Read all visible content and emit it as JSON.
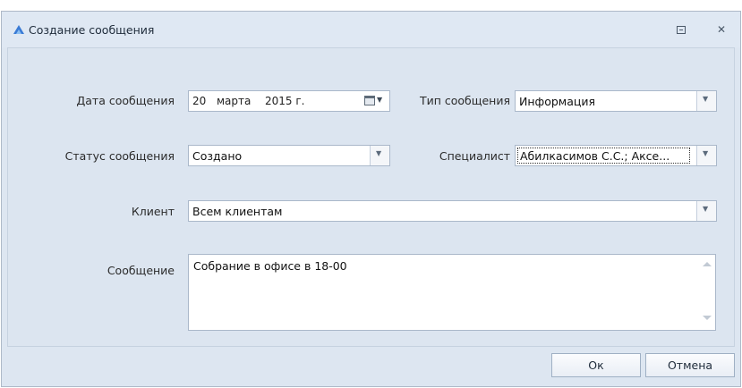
{
  "window": {
    "title": "Создание сообщения",
    "icons": {
      "app": "triangle-app-icon",
      "restore": "restore-icon",
      "close": "close-icon"
    }
  },
  "form": {
    "date": {
      "label": "Дата сообщения",
      "day": "20",
      "month": "марта",
      "year": "2015 г.",
      "icon": "calendar-icon"
    },
    "type": {
      "label": "Тип сообщения",
      "value": "Информация"
    },
    "status": {
      "label": "Статус сообщения",
      "value": "Создано"
    },
    "specialist": {
      "label": "Специалист",
      "value": "Абилкасимов С.С.; Аксе..."
    },
    "client": {
      "label": "Клиент",
      "value": "Всем клиентам"
    },
    "message": {
      "label": "Сообщение",
      "value": "Собрание в офисе в 18-00"
    }
  },
  "buttons": {
    "ok": "Ок",
    "cancel": "Отмена"
  },
  "colors": {
    "background": "#dce5f0",
    "accent": "#3a7bd5",
    "border": "#aab8ca"
  }
}
